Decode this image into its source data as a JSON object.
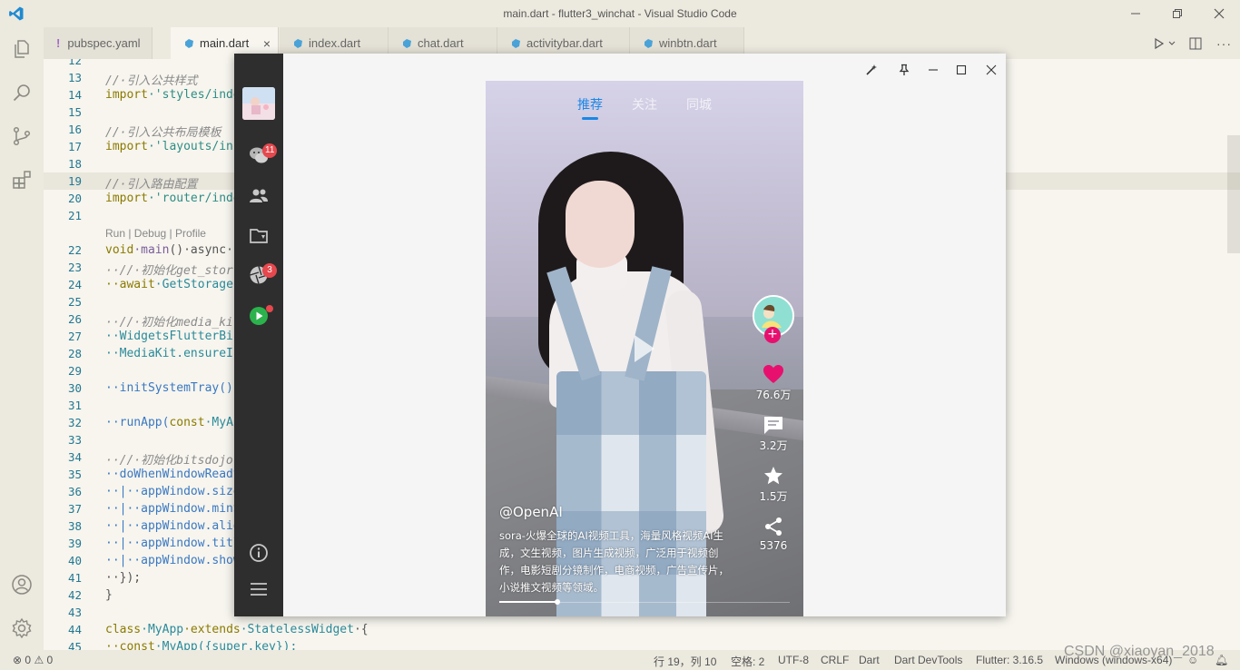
{
  "window": {
    "title": "main.dart - flutter3_winchat - Visual Studio Code"
  },
  "tabs": [
    {
      "label": "pubspec.yaml",
      "icon": "exclamation-icon"
    },
    {
      "label": "main.dart",
      "icon": "dart-icon",
      "active": true
    },
    {
      "label": "index.dart",
      "icon": "dart-icon"
    },
    {
      "label": "chat.dart",
      "icon": "dart-icon"
    },
    {
      "label": "activitybar.dart",
      "icon": "dart-icon"
    },
    {
      "label": "winbtn.dart",
      "icon": "dart-icon"
    }
  ],
  "editor": {
    "codelens": "Run | Debug | Profile",
    "line_numbers": [
      "12",
      "13",
      "14",
      "15",
      "16",
      "17",
      "18",
      "19",
      "20",
      "21",
      "22",
      "23",
      "24",
      "25",
      "26",
      "27",
      "28",
      "29",
      "30",
      "31",
      "32",
      "33",
      "34",
      "35",
      "36",
      "37",
      "38",
      "39",
      "40",
      "41",
      "42",
      "43",
      "44",
      "45"
    ],
    "lines": {
      "l13": "//·引入公共样式",
      "l14_kw": "import",
      "l14_str": "·'styles/inde",
      "l16": "//·引入公共布局模板",
      "l17_kw": "import",
      "l17_str": "·'layouts/inc",
      "l19": "//·引入路由配置",
      "l20_kw": "import",
      "l20_str": "·'router/inde",
      "l22_kw": "void",
      "l22_fn": "·main",
      "l22_rest": "()·async·{",
      "l23": "··//·初始化get_stor",
      "l24_kw": "··await",
      "l24_rest": "·GetStorage.",
      "l26": "··//·初始化media_ki",
      "l27": "··WidgetsFlutterBin",
      "l28": "··MediaKit.ensureIn",
      "l30": "··initSystemTray();",
      "l32_fn": "··runApp(",
      "l32_kw": "const",
      "l32_rest": "·MyAp",
      "l34": "··//·初始化bitsdojo",
      "l35": "··doWhenWindowReady",
      "l36": "··|··appWindow.size",
      "l37": "··|··appWindow.minSi",
      "l38": "··|··appWindow.aligr",
      "l39": "··|··appWindow.title",
      "l40": "··|··appWindow.showe",
      "l41": "··});",
      "l42": "}",
      "l44_kw": "class",
      "l44_cls": "·MyApp",
      "l44_kw2": "·extends",
      "l44_cls2": "·StatelessWidget",
      "l44_rest": "·{",
      "l45_kw": "··const",
      "l45_rest": "·MyApp({super.key});"
    }
  },
  "statusbar": {
    "errors": "0",
    "warnings": "0",
    "position": "行 19，列 10",
    "spaces": "空格: 2",
    "encoding": "UTF-8",
    "eol": "CRLF",
    "language": "Dart",
    "devtools": "Dart DevTools",
    "flutter": "Flutter: 3.16.5",
    "device": "Windows (windows-x64)"
  },
  "watermark": "CSDN @xiaoyan_2018",
  "app": {
    "sidebar": {
      "chat_badge": "11",
      "moments_badge": "3"
    },
    "video": {
      "tabs": [
        "推荐",
        "关注",
        "同城"
      ],
      "active_tab": 0,
      "like_count": "76.6万",
      "comment_count": "3.2万",
      "favorite_count": "1.5万",
      "share_count": "5376",
      "author": "@OpenAI",
      "description": "sora-火爆全球的AI视频工具，海量风格视频AI生成，文生视频，图片生成视频，广泛用于视频创作，电影短剧分镜制作，电商视频，广告宣传片，小说推文视频等领域。",
      "progress": 0.2
    },
    "colors": {
      "accent": "#1a87e6",
      "like": "#e8106e",
      "badge": "#e5484d",
      "sidebar_bg": "#2e2e2e"
    }
  }
}
